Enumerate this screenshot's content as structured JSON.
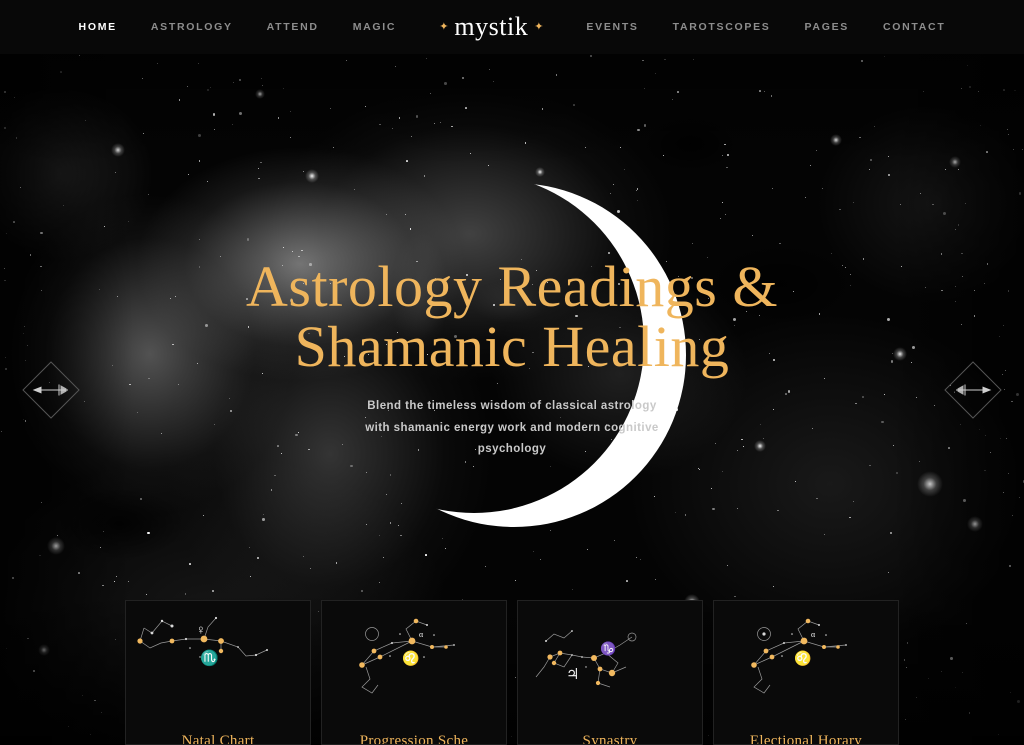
{
  "nav": {
    "left_items": [
      {
        "label": "HOME",
        "active": true
      },
      {
        "label": "ASTROLOGY",
        "active": false
      },
      {
        "label": "ATTEND",
        "active": false
      },
      {
        "label": "MAGIC",
        "active": false
      }
    ],
    "logo": {
      "text": "mystik",
      "left_sparkle": "✦",
      "right_sparkle": "✦"
    },
    "right_items": [
      {
        "label": "EVENTS",
        "active": false
      },
      {
        "label": "TAROTSCOPES",
        "active": false
      },
      {
        "label": "PAGES",
        "active": false
      },
      {
        "label": "CONTACT",
        "active": false
      }
    ]
  },
  "hero": {
    "title_line_1": "Astrology Readings &",
    "title_line_2": "Shamanic Healing",
    "subtitle": "Blend the timeless wisdom of classical astrology with shamanic energy work and modern cognitive psychology",
    "prev_arrow_icon": "arrow-left-dagger-icon",
    "next_arrow_icon": "arrow-right-dagger-icon",
    "moon_icon": "crescent-moon-icon"
  },
  "cards": [
    {
      "title": "Natal Chart",
      "constellation": "Scorpio",
      "glyph": "♏",
      "planet_glyph": "♀"
    },
    {
      "title": "Progression Sche",
      "constellation": "Leo",
      "glyph": "♌",
      "planet_glyph": "☉"
    },
    {
      "title": "Synastry",
      "constellation": "Sagittarius",
      "glyph": "♑",
      "planet_glyph": "♃"
    },
    {
      "title": "Electional Horary",
      "constellation": "Leo",
      "glyph": "♌",
      "planet_glyph": "☉"
    }
  ],
  "colors": {
    "accent_gold": "#efb55c",
    "nav_bg": "#080808",
    "nav_inactive": "#8d8d8d",
    "nav_active": "#ffffff",
    "card_bg": "#0a0a0a",
    "subtitle": "#c9c9c9"
  }
}
